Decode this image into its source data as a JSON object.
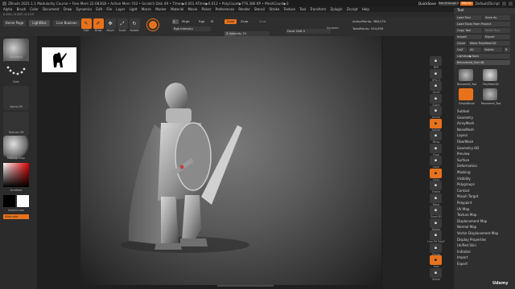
{
  "title_bar": {
    "text": "ZBrush 2021.1.1 Modularity Course • Free Mem 22.083GB • Active Mem 703 • Scratch Disk 49 • Timer▶0.001 ATime▶0.012 • PolyCount▶776.386 KP • MeshCount▶3",
    "quicksave": "QuickSave",
    "see_through": "See-through 0",
    "menus": "Menus",
    "default_script": "DefaultZScript"
  },
  "menu_bar": {
    "items": [
      "Alpha",
      "Brush",
      "Color",
      "Document",
      "Draw",
      "Dynamics",
      "Edit",
      "File",
      "Layer",
      "Light",
      "Macro",
      "Marker",
      "Material",
      "Movie",
      "Picker",
      "Preferences",
      "Render",
      "Stencil",
      "Stroke",
      "Texture",
      "Tool",
      "Transform",
      "Zplugin",
      "Zscript",
      "Help"
    ]
  },
  "coords": "0.241,-0.207,-0.113",
  "shelf": {
    "home_page": "Home Page",
    "lightbox": "LightBox",
    "live_boolean": "Live Boolean",
    "tools": [
      {
        "icon": "edit-icon",
        "label": "Edit",
        "active": true
      },
      {
        "icon": "draw-icon",
        "label": "Draw",
        "active": true
      },
      {
        "icon": "move-icon",
        "label": "Move",
        "active": false
      },
      {
        "icon": "scale-icon",
        "label": "Scale",
        "active": false
      },
      {
        "icon": "rotate-icon",
        "label": "Rotate",
        "active": false
      }
    ],
    "material_mode": "Mrgb",
    "rgb_mode": "Rgb",
    "m_mode": "M",
    "zadd": "Zadd",
    "zsub": "Zsub",
    "zcut": "Zcut",
    "a_label": "A",
    "rgb_intensity": "Rgb Intensity",
    "z_intensity_label": "Z Intensity",
    "z_intensity_value": "25",
    "focal_shift_label": "Focal Shift",
    "focal_shift_value": "0",
    "draw_size_label": "Draw Size",
    "draw_size_value": "64",
    "dynamic": "Dynamic",
    "active_points": "ActivePoints: 388,074",
    "total_points": "TotalPoints: 534,839"
  },
  "left_panel": {
    "brush_label": "Standard",
    "stroke_label": "Dots",
    "alpha_label": "Alpha Off",
    "texture_label": "Texture Off",
    "material_label": "MatCap Gray",
    "gradient_label": "Gradient",
    "switch_color": "SwitchColor",
    "alternate": "Alternate"
  },
  "right_strip": {
    "buttons": [
      {
        "icon": "bpr-icon",
        "label": "BPR"
      },
      {
        "icon": "spix-icon",
        "label": "SPix 3"
      },
      {
        "icon": "scroll-icon",
        "label": "Scroll"
      },
      {
        "icon": "zoom-icon",
        "label": "Zoom"
      },
      {
        "icon": "actual-icon",
        "label": "Actual"
      },
      {
        "icon": "aahalf-icon",
        "label": "AAHalf"
      },
      {
        "icon": "persp-icon",
        "label": "Persp"
      },
      {
        "icon": "floor-icon",
        "label": "Floor"
      },
      {
        "icon": "local-icon",
        "label": "Local"
      },
      {
        "icon": "xyz-icon",
        "label": "Gxyz"
      },
      {
        "icon": "frame-icon",
        "label": "Frame"
      },
      {
        "icon": "move-view-icon",
        "label": "Move"
      },
      {
        "icon": "zoom3d-icon",
        "label": "Zoom3D"
      },
      {
        "icon": "rotate-view-icon",
        "label": "Rotate"
      },
      {
        "icon": "linefill-icon",
        "label": "Line Fill PolyF"
      },
      {
        "icon": "transp-icon",
        "label": "Transp"
      },
      {
        "icon": "solo-icon",
        "label": "Solo"
      },
      {
        "icon": "xpose-icon",
        "label": "Xpose"
      }
    ]
  },
  "tool_panel": {
    "header": "Tool",
    "load_tool": "Load Tool",
    "save_as": "Save As",
    "load_tools_from_project": "Load Tools From Project",
    "copy_tool": "Copy Tool",
    "paste_tool": "Paste Tool",
    "import": "Import",
    "export": "Export",
    "clone": "Clone",
    "make_polymesh": "Make PolyMesh3D",
    "goz": "GoZ",
    "all": "All",
    "visible": "Visible",
    "r": "R",
    "lightbox_tools": "Lightbox▶Tools",
    "recovered_tool_label": "Recovered_Tool",
    "recovered_tool_value": "48",
    "tiles": [
      {
        "label": "Recovered_Tool"
      },
      {
        "label": "PolyMesh3D"
      },
      {
        "label": "SimpleBrush"
      },
      {
        "label": "Recovered_Tool"
      }
    ],
    "subpalettes": [
      "Subtool",
      "Geometry",
      "ArrayMesh",
      "NanoMesh",
      "Layers",
      "FiberMesh",
      "Geometry HD",
      "Preview",
      "Surface",
      "Deformation",
      "Masking",
      "Visibility",
      "Polygroups",
      "Contact",
      "Morph Target",
      "Polypaint",
      "UV Map",
      "Texture Map",
      "Displacement Map",
      "Normal Map",
      "Vector Displacement Map",
      "Display Properties",
      "Unified Skin",
      "Initialize",
      "Import",
      "Export"
    ]
  },
  "watermark": "Udemy",
  "colors": {
    "accent": "#e8721c",
    "panel": "#2f2f2f",
    "background": "#2a2a2a"
  }
}
